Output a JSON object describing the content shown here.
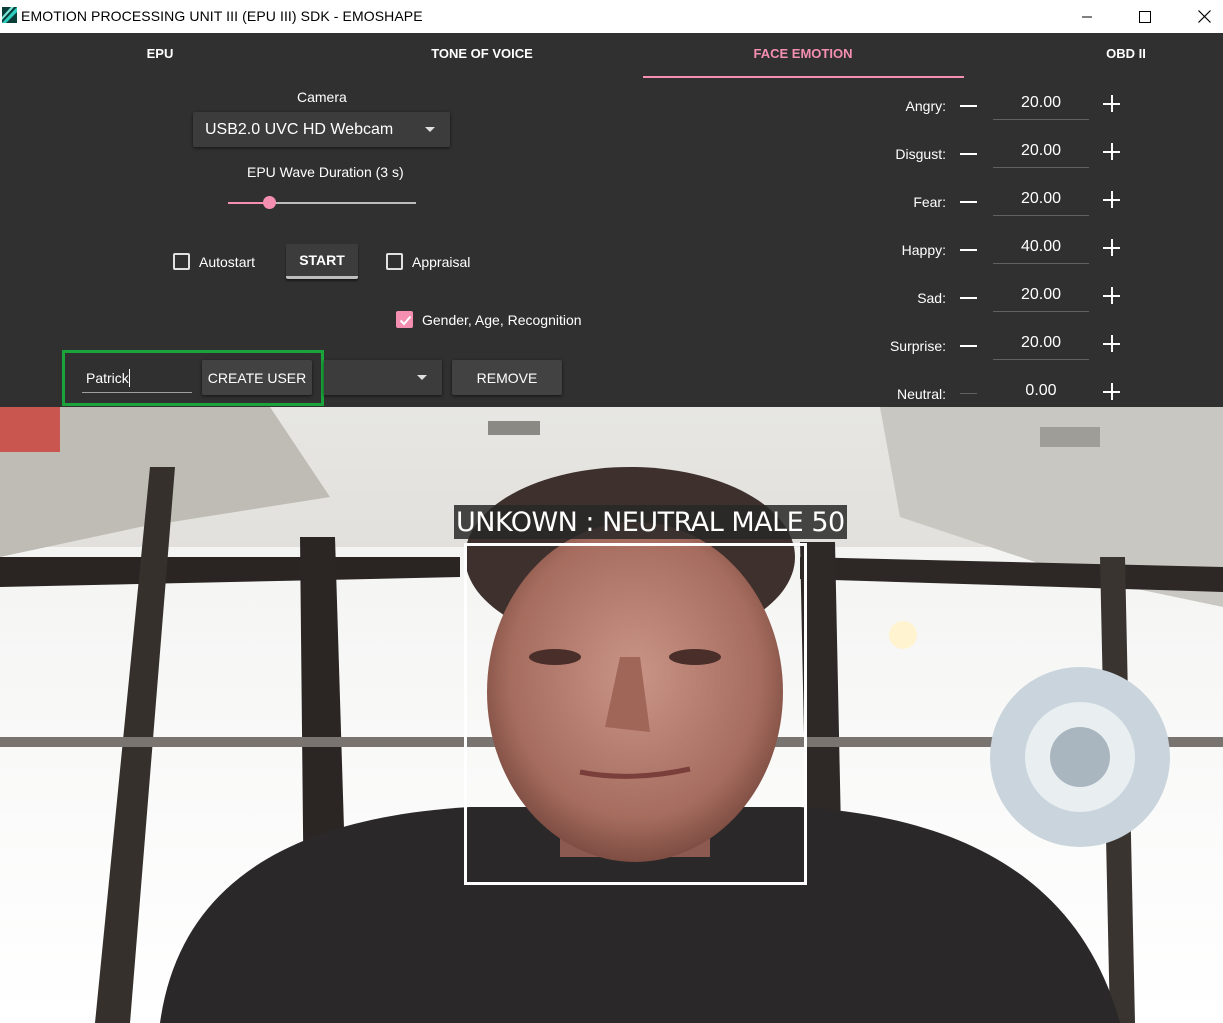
{
  "window": {
    "title": "EMOTION PROCESSING UNIT III (EPU III) SDK - EMOSHAPE",
    "controls": [
      "minimize-icon",
      "maximize-icon",
      "close-icon"
    ]
  },
  "tabs": [
    {
      "label": "EPU",
      "active": false
    },
    {
      "label": "TONE OF VOICE",
      "active": false
    },
    {
      "label": "FACE EMOTION",
      "active": true
    },
    {
      "label": "OBD II",
      "active": false
    }
  ],
  "camera": {
    "label": "Camera",
    "selected": "USB2.0 UVC HD Webcam"
  },
  "wave": {
    "label": "EPU Wave Duration (3 s)",
    "value_fraction": 0.22
  },
  "options": {
    "autostart": {
      "label": "Autostart",
      "checked": false
    },
    "start_label": "START",
    "appraisal": {
      "label": "Appraisal",
      "checked": false
    },
    "gender": {
      "label": "Gender, Age, Recognition",
      "checked": true
    }
  },
  "user": {
    "input_value": "Patrick",
    "create_label": "CREATE USER",
    "selected_user": "",
    "remove_label": "REMOVE"
  },
  "emotions": [
    {
      "label": "Angry:",
      "value": "20.00"
    },
    {
      "label": "Disgust:",
      "value": "20.00"
    },
    {
      "label": "Fear:",
      "value": "20.00"
    },
    {
      "label": "Happy:",
      "value": "40.00"
    },
    {
      "label": "Sad:",
      "value": "20.00"
    },
    {
      "label": "Surprise:",
      "value": "20.00"
    },
    {
      "label": "Neutral:",
      "value": "0.00"
    }
  ],
  "detection": {
    "label": "UNKOWN : NEUTRAL MALE 50"
  },
  "colors": {
    "accent": "#f48fb1",
    "background": "#303030",
    "highlight": "#1aa33a"
  }
}
